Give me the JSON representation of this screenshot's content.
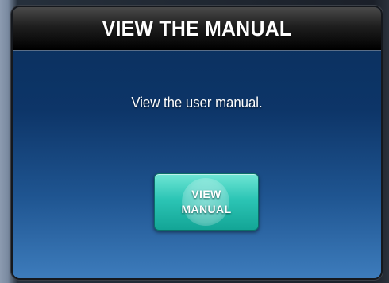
{
  "dialog": {
    "title": "VIEW THE MANUAL",
    "message": "View the user manual.",
    "button": {
      "label_line1": "VIEW",
      "label_line2": "MANUAL"
    }
  },
  "colors": {
    "titlebar": "#000000",
    "panel_top": "#0a2f5c",
    "panel_bottom": "#3d7cbc",
    "button": "#2cc5b5",
    "text": "#ffffff"
  }
}
